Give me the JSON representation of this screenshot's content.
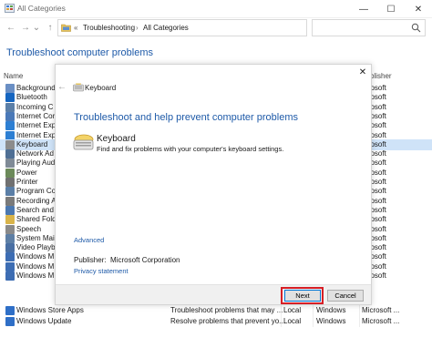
{
  "window": {
    "title": "All Categories",
    "minimize_glyph": "—",
    "maximize_glyph": "☐",
    "close_glyph": "✕"
  },
  "nav": {
    "back_glyph": "←",
    "forward_glyph": "→",
    "recent_glyph": "⌄",
    "up_glyph": "↑",
    "breadcrumb_overflow": "«",
    "breadcrumb": [
      "Troubleshooting",
      "All Categories"
    ],
    "breadcrumb_separator": "›",
    "dropdown_glyph": "⌄",
    "refresh_glyph": "↻",
    "search_placeholder": ""
  },
  "page": {
    "heading": "Troubleshoot computer problems",
    "columns": {
      "name": "Name",
      "publisher": "blisher"
    }
  },
  "list": {
    "items": [
      {
        "name": "Background",
        "publisher": "icrosoft",
        "icon_color": "#6a8fc4",
        "selected": false
      },
      {
        "name": "Bluetooth",
        "publisher": "icrosoft",
        "icon_color": "#1565c0",
        "selected": false
      },
      {
        "name": "Incoming C",
        "publisher": "icrosoft",
        "icon_color": "#5b7fa8",
        "selected": false
      },
      {
        "name": "Internet Cor",
        "publisher": "icrosoft",
        "icon_color": "#4a79b8",
        "selected": false
      },
      {
        "name": "Internet Exp",
        "publisher": "icrosoft",
        "icon_color": "#2d7fd3",
        "selected": false
      },
      {
        "name": "Internet Exp",
        "publisher": "icrosoft",
        "icon_color": "#2d7fd3",
        "selected": false
      },
      {
        "name": "Keyboard",
        "publisher": "icrosoft",
        "icon_color": "#8c8c8c",
        "selected": true
      },
      {
        "name": "Network Ad",
        "publisher": "icrosoft",
        "icon_color": "#4f6f94",
        "selected": false
      },
      {
        "name": "Playing Aud",
        "publisher": "icrosoft",
        "icon_color": "#7f8a96",
        "selected": false
      },
      {
        "name": "Power",
        "publisher": "icrosoft",
        "icon_color": "#6c8a5a",
        "selected": false
      },
      {
        "name": "Printer",
        "publisher": "icrosoft",
        "icon_color": "#707070",
        "selected": false
      },
      {
        "name": "Program Co",
        "publisher": "icrosoft",
        "icon_color": "#5a7ea6",
        "selected": false
      },
      {
        "name": "Recording A",
        "publisher": "icrosoft",
        "icon_color": "#7a7a7a",
        "selected": false
      },
      {
        "name": "Search and I",
        "publisher": "icrosoft",
        "icon_color": "#4b78b0",
        "selected": false
      },
      {
        "name": "Shared Fold",
        "publisher": "icrosoft",
        "icon_color": "#d9b44a",
        "selected": false
      },
      {
        "name": "Speech",
        "publisher": "icrosoft",
        "icon_color": "#8a8a8a",
        "selected": false
      },
      {
        "name": "System Mair",
        "publisher": "icrosoft",
        "icon_color": "#5e7fa5",
        "selected": false
      },
      {
        "name": "Video Playb",
        "publisher": "icrosoft",
        "icon_color": "#4a6fa3",
        "selected": false
      },
      {
        "name": "Windows M",
        "publisher": "icrosoft",
        "icon_color": "#3d6db3",
        "selected": false
      },
      {
        "name": "Windows M",
        "publisher": "icrosoft",
        "icon_color": "#3d6db3",
        "selected": false
      },
      {
        "name": "Windows M",
        "publisher": "icrosoft",
        "icon_color": "#3d6db3",
        "selected": false
      }
    ],
    "full_rows": [
      {
        "name": "Windows Store Apps",
        "description": "Troubleshoot problems that may ...",
        "location": "Local",
        "category": "Windows",
        "publisher": "Microsoft ...",
        "icon_color": "#2f6fc7"
      },
      {
        "name": "Windows Update",
        "description": "Resolve problems that prevent yo...",
        "location": "Local",
        "category": "Windows",
        "publisher": "Microsoft ...",
        "icon_color": "#2f6fc7"
      }
    ]
  },
  "dialog": {
    "close_glyph": "✕",
    "back_glyph": "←",
    "header_name": "Keyboard",
    "main_title": "Troubleshoot and help prevent computer problems",
    "item_title": "Keyboard",
    "item_description": "Find and fix problems with your computer's keyboard settings.",
    "advanced_link": "Advanced",
    "publisher_label": "Publisher:",
    "publisher_value": "Microsoft Corporation",
    "privacy_link": "Privacy statement",
    "next_button": "Next",
    "cancel_button": "Cancel",
    "highlight_color": "#d61f26",
    "accent_color": "#1e5aa8"
  }
}
